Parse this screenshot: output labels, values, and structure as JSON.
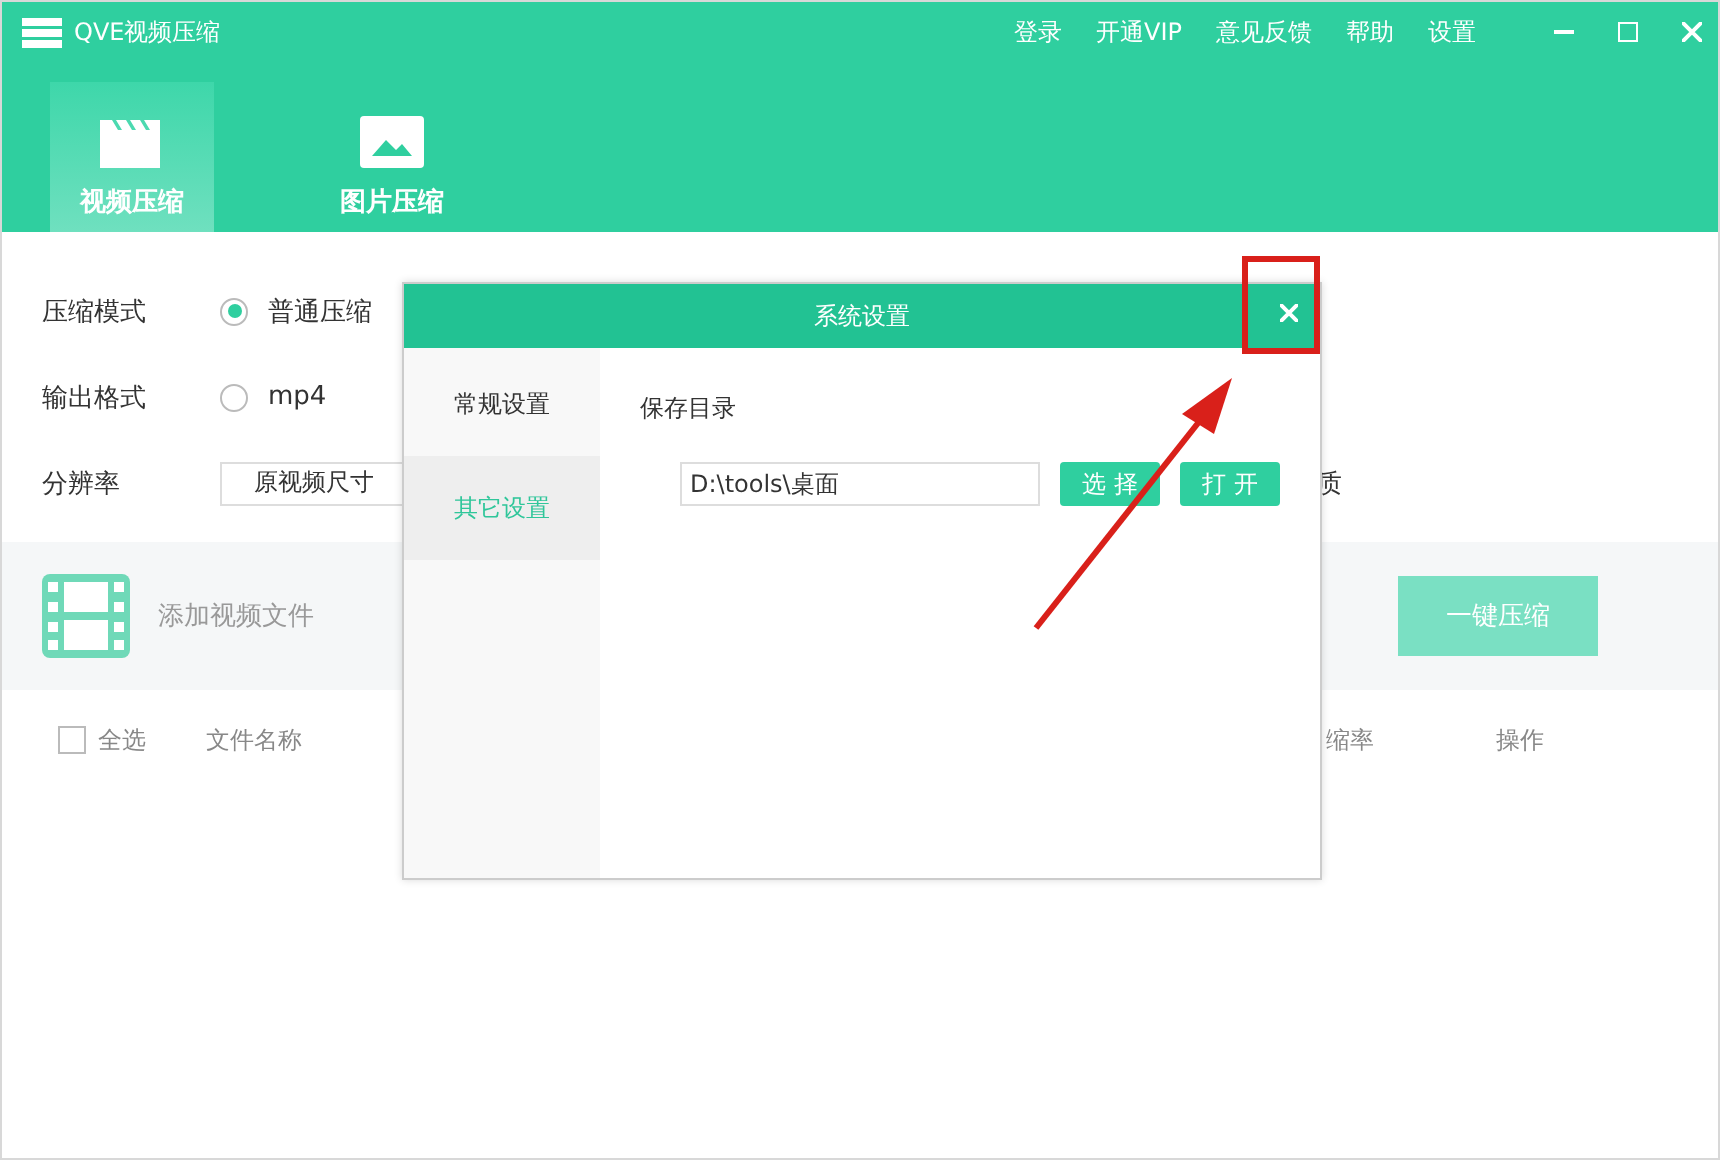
{
  "app": {
    "title": "QVE视频压缩",
    "menu": [
      "登录",
      "开通VIP",
      "意见反馈",
      "帮助",
      "设置"
    ]
  },
  "tabs": [
    {
      "label": "视频压缩",
      "selected": true,
      "kind": "video"
    },
    {
      "label": "图片压缩",
      "selected": false,
      "kind": "image"
    }
  ],
  "options": [
    {
      "label": "压缩模式",
      "kind": "radio",
      "value": "普通压缩",
      "checked": true
    },
    {
      "label": "输出格式",
      "kind": "radio",
      "value": "mp4",
      "checked": false
    },
    {
      "label": "分辨率",
      "kind": "select",
      "value": "原视频尺寸",
      "trailing_text": "质"
    }
  ],
  "add_bar": {
    "label": "添加视频文件",
    "button": "一键压缩"
  },
  "table": {
    "select_all": {
      "label": "全选",
      "checked": false
    },
    "columns": [
      "文件名称",
      "缩率",
      "操作"
    ]
  },
  "dialog": {
    "title": "系统设置",
    "nav": [
      {
        "label": "常规设置",
        "selected": false
      },
      {
        "label": "其它设置",
        "selected": true
      }
    ],
    "section": "保存目录",
    "path": "D:\\tools\\桌面",
    "buttons": [
      "选 择",
      "打 开"
    ]
  }
}
